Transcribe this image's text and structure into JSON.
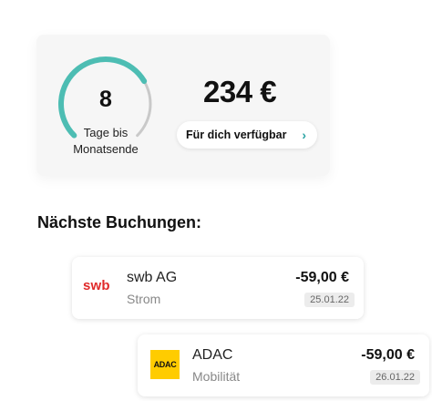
{
  "summary": {
    "days_left": "8",
    "days_caption_line1": "Tage bis",
    "days_caption_line2": "Monatsende",
    "gauge_progress": 0.72,
    "accent_color": "#4dbdb3",
    "track_color": "#c9c9c9",
    "amount": "234 €",
    "available_label": "Für dich verfügbar",
    "available_icon": "chevron-right-icon"
  },
  "upcoming": {
    "title": "Nächste Buchungen:",
    "items": [
      {
        "logo_text": "swb",
        "logo_icon": "swb-logo",
        "merchant": "swb AG",
        "category": "Strom",
        "amount": "-59,00 €",
        "date": "25.01.22"
      },
      {
        "logo_text": "ADAC",
        "logo_icon": "adac-logo",
        "merchant": "ADAC",
        "category": "Mobilität",
        "amount": "-59,00 €",
        "date": "26.01.22"
      }
    ]
  }
}
